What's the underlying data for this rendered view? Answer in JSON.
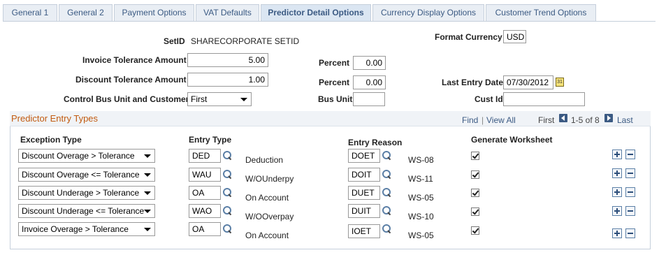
{
  "tabs": [
    {
      "label": "General 1"
    },
    {
      "label": "General 2"
    },
    {
      "label": "Payment Options"
    },
    {
      "label": "VAT Defaults"
    },
    {
      "label": "Predictor Detail Options"
    },
    {
      "label": "Currency Display Options"
    },
    {
      "label": "Customer Trend Options"
    }
  ],
  "header": {
    "setid_label": "SetID",
    "setid_value": "SHARECORPORATE SETID",
    "format_currency_label": "Format Currency",
    "format_currency_value": "USD",
    "invoice_tol_label": "Invoice Tolerance Amount",
    "invoice_tol_value": "5.00",
    "discount_tol_label": "Discount Tolerance Amount",
    "discount_tol_value": "1.00",
    "percent_label": "Percent",
    "percent1_value": "0.00",
    "percent2_value": "0.00",
    "last_entry_label": "Last Entry Date",
    "last_entry_value": "07/30/2012",
    "control_label": "Control Bus Unit and Customer",
    "control_value": "First",
    "bus_unit_label": "Bus Unit",
    "bus_unit_value": "",
    "cust_id_label": "Cust Id",
    "cust_id_value": ""
  },
  "grid": {
    "title": "Predictor Entry Types",
    "find": "Find",
    "sep": "|",
    "view_all": "View All",
    "first": "First",
    "range": "1-5 of 8",
    "last": "Last",
    "col_exception": "Exception Type",
    "col_entry_type": "Entry Type",
    "col_entry_reason": "Entry Reason",
    "col_generate": "Generate Worksheet",
    "rows": [
      {
        "exception": "Discount Overage > Tolerance",
        "entry_type": "DED",
        "entry_desc": "Deduction",
        "reason": "DOET",
        "ws": "WS-08",
        "generate": true
      },
      {
        "exception": "Discount Overage <= Tolerance",
        "entry_type": "WAU",
        "entry_desc": "W/OUnderpy",
        "reason": "DOIT",
        "ws": "WS-11",
        "generate": true
      },
      {
        "exception": "Discount Underage > Tolerance",
        "entry_type": "OA",
        "entry_desc": "On Account",
        "reason": "DUET",
        "ws": "WS-05",
        "generate": true
      },
      {
        "exception": "Discount Underage <= Tolerance",
        "entry_type": "WAO",
        "entry_desc": "W/OOverpay",
        "reason": "DUIT",
        "ws": "WS-10",
        "generate": true
      },
      {
        "exception": "Invoice Overage > Tolerance",
        "entry_type": "OA",
        "entry_desc": "On Account",
        "reason": "IOET",
        "ws": "WS-05",
        "generate": true
      }
    ]
  },
  "colors": {
    "tab_text": "#3b5a83",
    "grid_title": "#c25b11",
    "link": "#3b5a83"
  }
}
